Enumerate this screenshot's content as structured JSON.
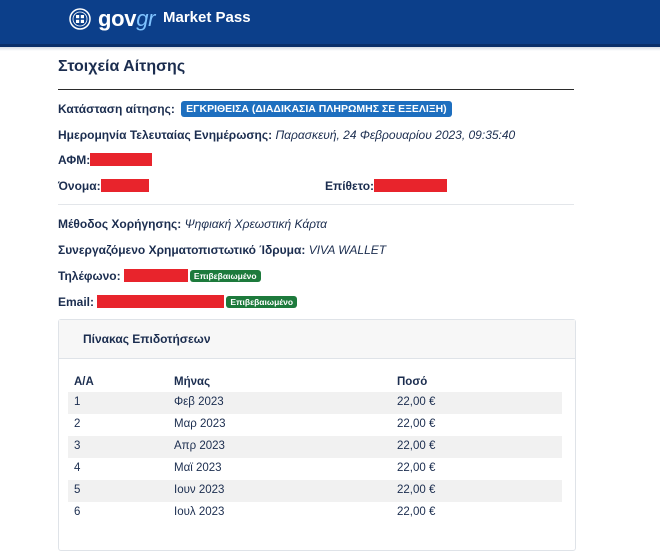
{
  "header": {
    "logo_main": "gov",
    "logo_accent": "gr",
    "app_title": "Market Pass"
  },
  "page": {
    "title": "Στοιχεία Αίτησης"
  },
  "details": {
    "status_label": "Κατάσταση αίτησης:",
    "status_value": "ΕΓΚΡΙΘΕΙΣΑ (ΔΙΑΔΙΚΑΣΙΑ ΠΛΗΡΩΜΗΣ ΣΕ ΕΞΕΛΙΞΗ)",
    "updated_label": "Ημερομηνία Τελευταίας Ενημέρωσης:",
    "updated_value": "Παρασκευή, 24 Φεβρουαρίου 2023, 09:35:40",
    "afm_label": "ΑΦΜ:",
    "name_label": "Όνομα:",
    "surname_label": "Επίθετο:",
    "method_label": "Μέθοδος Χορήγησης:",
    "method_value": "Ψηφιακή Χρεωστική Κάρτα",
    "bank_label": "Συνεργαζόμενο Χρηματοπιστωτικό Ίδρυμα:",
    "bank_value": "VIVA WALLET",
    "phone_label": "Τηλέφωνο:",
    "phone_badge": "Επιβεβαιωμένο",
    "email_label": "Email:",
    "email_badge": "Επιβεβαιωμένο"
  },
  "subsidies": {
    "title": "Πίνακας Επιδοτήσεων",
    "columns": [
      "Α/Α",
      "Μήνας",
      "Ποσό"
    ],
    "rows": [
      [
        "1",
        "Φεβ 2023",
        "22,00 €"
      ],
      [
        "2",
        "Μαρ 2023",
        "22,00 €"
      ],
      [
        "3",
        "Απρ 2023",
        "22,00 €"
      ],
      [
        "4",
        "Μαϊ 2023",
        "22,00 €"
      ],
      [
        "5",
        "Ιουν 2023",
        "22,00 €"
      ],
      [
        "6",
        "Ιουλ 2023",
        "22,00 €"
      ]
    ]
  },
  "colors": {
    "header_bg": "#0c3f8a",
    "status_badge": "#1e6fbf",
    "verified_badge": "#1d7a3c",
    "redaction": "#e8242c"
  }
}
